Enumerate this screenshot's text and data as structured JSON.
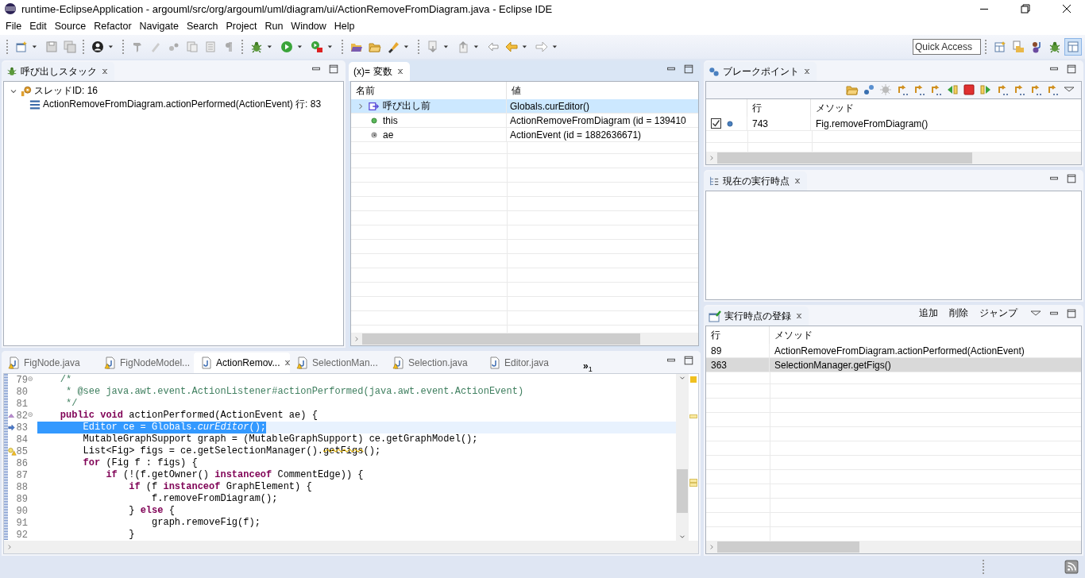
{
  "window": {
    "title": "runtime-EclipseApplication - argouml/src/org/argouml/uml/diagram/ui/ActionRemoveFromDiagram.java - Eclipse IDE"
  },
  "menu": [
    {
      "label": "File"
    },
    {
      "label": "Edit"
    },
    {
      "label": "Source"
    },
    {
      "label": "Refactor"
    },
    {
      "label": "Navigate"
    },
    {
      "label": "Search"
    },
    {
      "label": "Project"
    },
    {
      "label": "Run"
    },
    {
      "label": "Window"
    },
    {
      "label": "Help"
    }
  ],
  "toolbar": {
    "quick_access": {
      "placeholder": "Quick Access"
    },
    "perspectives": [
      {
        "selected": false
      },
      {
        "selected": false
      },
      {
        "selected": false
      },
      {
        "selected": false
      },
      {
        "selected": true
      }
    ]
  },
  "call_stack": {
    "title": "呼び出しスタック",
    "active": false,
    "tree": [
      {
        "label": "スレッドID: 16",
        "expanded": true,
        "children": [
          {
            "label": "ActionRemoveFromDiagram.actionPerformed(ActionEvent) 行: 83"
          }
        ]
      }
    ]
  },
  "variables": {
    "icon_text": "(x)=",
    "title": "変数",
    "active": true,
    "columns": [
      "名前",
      "値"
    ],
    "rows": [
      {
        "kind": "return",
        "expandable": true,
        "selected": true,
        "name": "呼び出し前",
        "value": "Globals.curEditor()"
      },
      {
        "kind": "field",
        "expandable": false,
        "selected": false,
        "name": "this",
        "value": "ActionRemoveFromDiagram (id = 139410"
      },
      {
        "kind": "local",
        "expandable": false,
        "selected": false,
        "name": "ae",
        "value": "ActionEvent (id = 1882636671)"
      }
    ]
  },
  "breakpoints": {
    "title": "ブレークポイント",
    "active": false,
    "columns": [
      "行",
      "メソッド"
    ],
    "rows": [
      {
        "checked": true,
        "line": "743",
        "method": "Fig.removeFromDiagram()"
      }
    ]
  },
  "current_point": {
    "title": "現在の実行時点",
    "active": false
  },
  "registry": {
    "title": "実行時点の登録",
    "active": false,
    "actions": [
      "追加",
      "削除",
      "ジャンプ"
    ],
    "columns": [
      "行",
      "メソッド"
    ],
    "rows": [
      {
        "line": "89",
        "method": "ActionRemoveFromDiagram.actionPerformed(ActionEvent)",
        "selected": false
      },
      {
        "line": "363",
        "method": "SelectionManager.getFigs()",
        "selected": true
      }
    ]
  },
  "editor": {
    "tabs": [
      {
        "label": "FigNode.java",
        "selected": false,
        "warning": true
      },
      {
        "label": "FigNodeModel...",
        "selected": false,
        "warning": true
      },
      {
        "label": "ActionRemov...",
        "selected": true,
        "warning": false
      },
      {
        "label": "SelectionMan...",
        "selected": false,
        "warning": true
      },
      {
        "label": "Selection.java",
        "selected": false,
        "warning": true
      },
      {
        "label": "Editor.java",
        "selected": false,
        "warning": false
      }
    ],
    "overflow": {
      "label": "»",
      "count": "1"
    },
    "lines": [
      {
        "number": "79",
        "fold": true,
        "current": false,
        "warning": false,
        "entry": false,
        "selected": false,
        "tokens": [
          {
            "kind": "comment",
            "text": "    /*"
          }
        ]
      },
      {
        "number": "80",
        "fold": false,
        "current": false,
        "warning": false,
        "entry": false,
        "selected": false,
        "tokens": [
          {
            "kind": "comment",
            "text": "     * @see java.awt.event.ActionListener#actionPerformed(java.awt.event.ActionEvent)"
          }
        ]
      },
      {
        "number": "81",
        "fold": false,
        "current": false,
        "warning": false,
        "entry": false,
        "selected": false,
        "tokens": [
          {
            "kind": "comment",
            "text": "     */"
          }
        ]
      },
      {
        "number": "82",
        "fold": true,
        "current": false,
        "warning": false,
        "entry": true,
        "selected": false,
        "tokens": [
          {
            "kind": "keyword",
            "text": "    public void"
          },
          {
            "kind": "plain",
            "text": " actionPerformed(ActionEvent ae) {"
          }
        ]
      },
      {
        "number": "83",
        "fold": false,
        "current": true,
        "warning": false,
        "entry": false,
        "selected": true,
        "tokens": [
          {
            "kind": "plain",
            "text": "        Editor ce = Globals."
          },
          {
            "kind": "static",
            "text": "curEditor"
          },
          {
            "kind": "plain",
            "text": "();"
          }
        ]
      },
      {
        "number": "84",
        "fold": false,
        "current": false,
        "warning": false,
        "entry": false,
        "selected": false,
        "tokens": [
          {
            "kind": "plain",
            "text": "        MutableGraphSupport graph = (MutableGraphSupport) ce.getGraphModel();"
          }
        ]
      },
      {
        "number": "85",
        "fold": false,
        "current": false,
        "warning": true,
        "entry": false,
        "selected": false,
        "tokens": [
          {
            "kind": "plain",
            "text": "        List<Fig> figs = ce.getSelectionManager()."
          },
          {
            "kind": "deprecated",
            "text": "getFigs"
          },
          {
            "kind": "plain",
            "text": "();"
          }
        ]
      },
      {
        "number": "86",
        "fold": false,
        "current": false,
        "warning": false,
        "entry": false,
        "selected": false,
        "tokens": [
          {
            "kind": "keyword",
            "text": "        for"
          },
          {
            "kind": "plain",
            "text": " (Fig f : figs) {"
          }
        ]
      },
      {
        "number": "87",
        "fold": false,
        "current": false,
        "warning": false,
        "entry": false,
        "selected": false,
        "tokens": [
          {
            "kind": "keyword",
            "text": "            if"
          },
          {
            "kind": "plain",
            "text": " (!(f.getOwner() "
          },
          {
            "kind": "keyword",
            "text": "instanceof"
          },
          {
            "kind": "plain",
            "text": " CommentEdge)) {"
          }
        ]
      },
      {
        "number": "88",
        "fold": false,
        "current": false,
        "warning": false,
        "entry": false,
        "selected": false,
        "tokens": [
          {
            "kind": "keyword",
            "text": "                if"
          },
          {
            "kind": "plain",
            "text": " (f "
          },
          {
            "kind": "keyword",
            "text": "instanceof"
          },
          {
            "kind": "plain",
            "text": " GraphElement) {"
          }
        ]
      },
      {
        "number": "89",
        "fold": false,
        "current": false,
        "warning": false,
        "entry": false,
        "selected": false,
        "tokens": [
          {
            "kind": "plain",
            "text": "                    f.removeFromDiagram();"
          }
        ]
      },
      {
        "number": "90",
        "fold": false,
        "current": false,
        "warning": false,
        "entry": false,
        "selected": false,
        "tokens": [
          {
            "kind": "plain",
            "text": "                } "
          },
          {
            "kind": "keyword",
            "text": "else"
          },
          {
            "kind": "plain",
            "text": " {"
          }
        ]
      },
      {
        "number": "91",
        "fold": false,
        "current": false,
        "warning": false,
        "entry": false,
        "selected": false,
        "tokens": [
          {
            "kind": "plain",
            "text": "                    graph.removeFig(f);"
          }
        ]
      },
      {
        "number": "92",
        "fold": false,
        "current": false,
        "warning": false,
        "entry": false,
        "selected": false,
        "tokens": [
          {
            "kind": "plain",
            "text": "                }"
          }
        ]
      }
    ]
  }
}
